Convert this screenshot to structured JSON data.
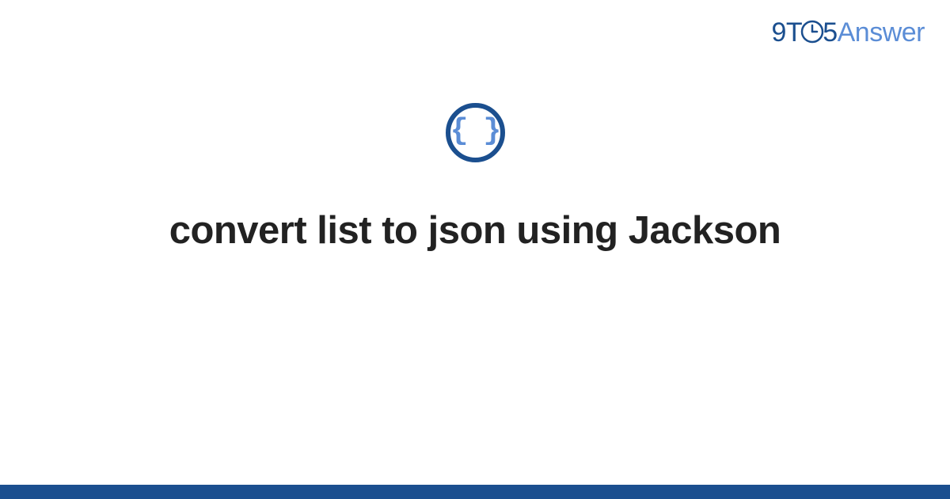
{
  "brand": {
    "part1": "9T",
    "part2": "5",
    "part3": "Answer"
  },
  "topic_icon": {
    "name": "code-braces-icon",
    "glyph": "{ }"
  },
  "title": "convert list to json using Jackson",
  "colors": {
    "primary": "#1b4f8f",
    "accent": "#5b8dd6"
  }
}
